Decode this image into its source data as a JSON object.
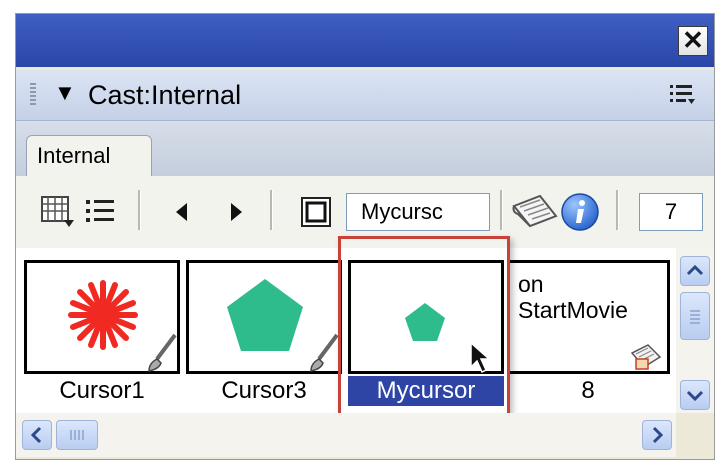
{
  "window": {
    "close_glyph": "✕"
  },
  "panel": {
    "title": "Cast:Internal"
  },
  "tabs": [
    {
      "label": "Internal"
    }
  ],
  "toolbar": {
    "member_name": "Mycursc",
    "member_number": "7"
  },
  "cast_members": [
    {
      "label": "Cursor1",
      "content": "red-star",
      "color": "#f02a22"
    },
    {
      "label": "Cursor3",
      "content": "green-pentagon",
      "color": "#2fbc8c"
    },
    {
      "label": "Mycursor",
      "content": "green-pentagon-small",
      "color": "#2fbc8c",
      "selected": true
    },
    {
      "label": "8",
      "content": "script",
      "script_lines": [
        "on",
        "StartMovie"
      ]
    }
  ],
  "colors": {
    "titlebar": "#2f4bb0",
    "selection": "#2f45a6",
    "highlight_frame": "#c7433a",
    "info_blue": "#2f6fd8"
  }
}
